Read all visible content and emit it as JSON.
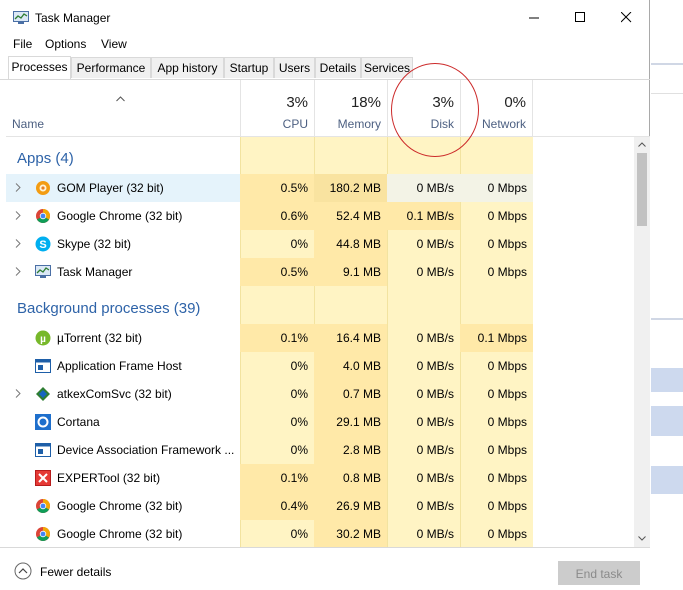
{
  "window": {
    "title": "Task Manager"
  },
  "menu": [
    "File",
    "Options",
    "View"
  ],
  "tabs": [
    {
      "label": "Processes",
      "active": true
    },
    {
      "label": "Performance"
    },
    {
      "label": "App history"
    },
    {
      "label": "Startup"
    },
    {
      "label": "Users"
    },
    {
      "label": "Details"
    },
    {
      "label": "Services"
    }
  ],
  "columns": {
    "name": "Name",
    "cpu": {
      "pct": "3%",
      "label": "CPU"
    },
    "memory": {
      "pct": "18%",
      "label": "Memory"
    },
    "disk": {
      "pct": "3%",
      "label": "Disk"
    },
    "network": {
      "pct": "0%",
      "label": "Network"
    }
  },
  "groups": {
    "apps": "Apps (4)",
    "background": "Background processes (39)"
  },
  "apps": [
    {
      "name": "GOM Player (32 bit)",
      "cpu": "0.5%",
      "memory": "180.2 MB",
      "disk": "0 MB/s",
      "network": "0 Mbps",
      "icon": "gom-player-icon"
    },
    {
      "name": "Google Chrome (32 bit)",
      "cpu": "0.6%",
      "memory": "52.4 MB",
      "disk": "0.1 MB/s",
      "network": "0 Mbps",
      "icon": "chrome-icon"
    },
    {
      "name": "Skype (32 bit)",
      "cpu": "0%",
      "memory": "44.8 MB",
      "disk": "0 MB/s",
      "network": "0 Mbps",
      "icon": "skype-icon"
    },
    {
      "name": "Task Manager",
      "cpu": "0.5%",
      "memory": "9.1 MB",
      "disk": "0 MB/s",
      "network": "0 Mbps",
      "icon": "task-manager-icon"
    }
  ],
  "background": [
    {
      "name": "µTorrent (32 bit)",
      "cpu": "0.1%",
      "memory": "16.4 MB",
      "disk": "0 MB/s",
      "network": "0.1 Mbps",
      "icon": "utorrent-icon"
    },
    {
      "name": "Application Frame Host",
      "cpu": "0%",
      "memory": "4.0 MB",
      "disk": "0 MB/s",
      "network": "0 Mbps",
      "icon": "app-frame-icon"
    },
    {
      "name": "atkexComSvc (32 bit)",
      "cpu": "0%",
      "memory": "0.7 MB",
      "disk": "0 MB/s",
      "network": "0 Mbps",
      "icon": "atkex-icon"
    },
    {
      "name": "Cortana",
      "cpu": "0%",
      "memory": "29.1 MB",
      "disk": "0 MB/s",
      "network": "0 Mbps",
      "icon": "cortana-icon"
    },
    {
      "name": "Device Association Framework ...",
      "cpu": "0%",
      "memory": "2.8 MB",
      "disk": "0 MB/s",
      "network": "0 Mbps",
      "icon": "device-assoc-icon"
    },
    {
      "name": "EXPERTool (32 bit)",
      "cpu": "0.1%",
      "memory": "0.8 MB",
      "disk": "0 MB/s",
      "network": "0 Mbps",
      "icon": "expertool-icon"
    },
    {
      "name": "Google Chrome (32 bit)",
      "cpu": "0.4%",
      "memory": "26.9 MB",
      "disk": "0 MB/s",
      "network": "0 Mbps",
      "icon": "chrome-icon"
    },
    {
      "name": "Google Chrome (32 bit)",
      "cpu": "0%",
      "memory": "30.2 MB",
      "disk": "0 MB/s",
      "network": "0 Mbps",
      "icon": "chrome-icon"
    }
  ],
  "footer": {
    "fewer_details": "Fewer details",
    "end_task": "End task"
  },
  "colors": {
    "accent": "#2e63a8",
    "heat_light": "#fff4c4",
    "heat_med": "#ffe9a8",
    "selected": "#e5f3fb",
    "annotation": "#cc2a2a"
  }
}
